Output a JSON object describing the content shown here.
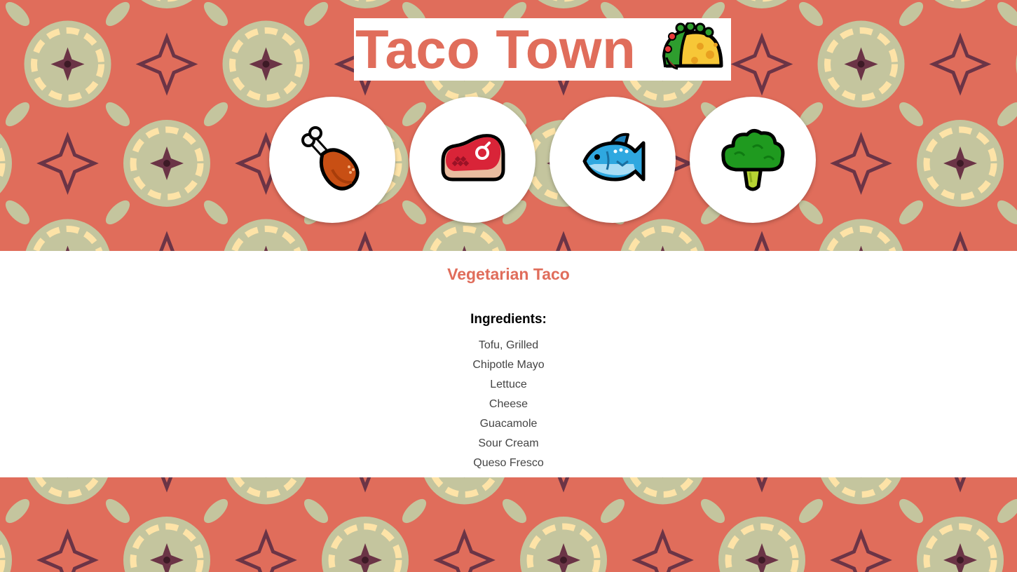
{
  "header": {
    "title": "Taco Town",
    "title_icon": "taco-icon"
  },
  "categories": [
    {
      "name": "Chicken",
      "icon": "poultry-leg-icon"
    },
    {
      "name": "Beef",
      "icon": "steak-icon"
    },
    {
      "name": "Fish",
      "icon": "fish-icon"
    },
    {
      "name": "Vegetarian",
      "icon": "broccoli-icon"
    }
  ],
  "recipe": {
    "title": "Vegetarian Taco",
    "ingredients_heading": "Ingredients:",
    "ingredients": [
      "Tofu, Grilled",
      "Chipotle Mayo",
      "Lettuce",
      "Cheese",
      "Guacamole",
      "Sour Cream",
      "Queso Fresco"
    ]
  },
  "colors": {
    "accent": "#e06d5b",
    "pattern_base": "#e06d5b",
    "pattern_sage": "#c4c59e",
    "pattern_cream": "#fde3a7",
    "pattern_plum": "#6b3446"
  }
}
